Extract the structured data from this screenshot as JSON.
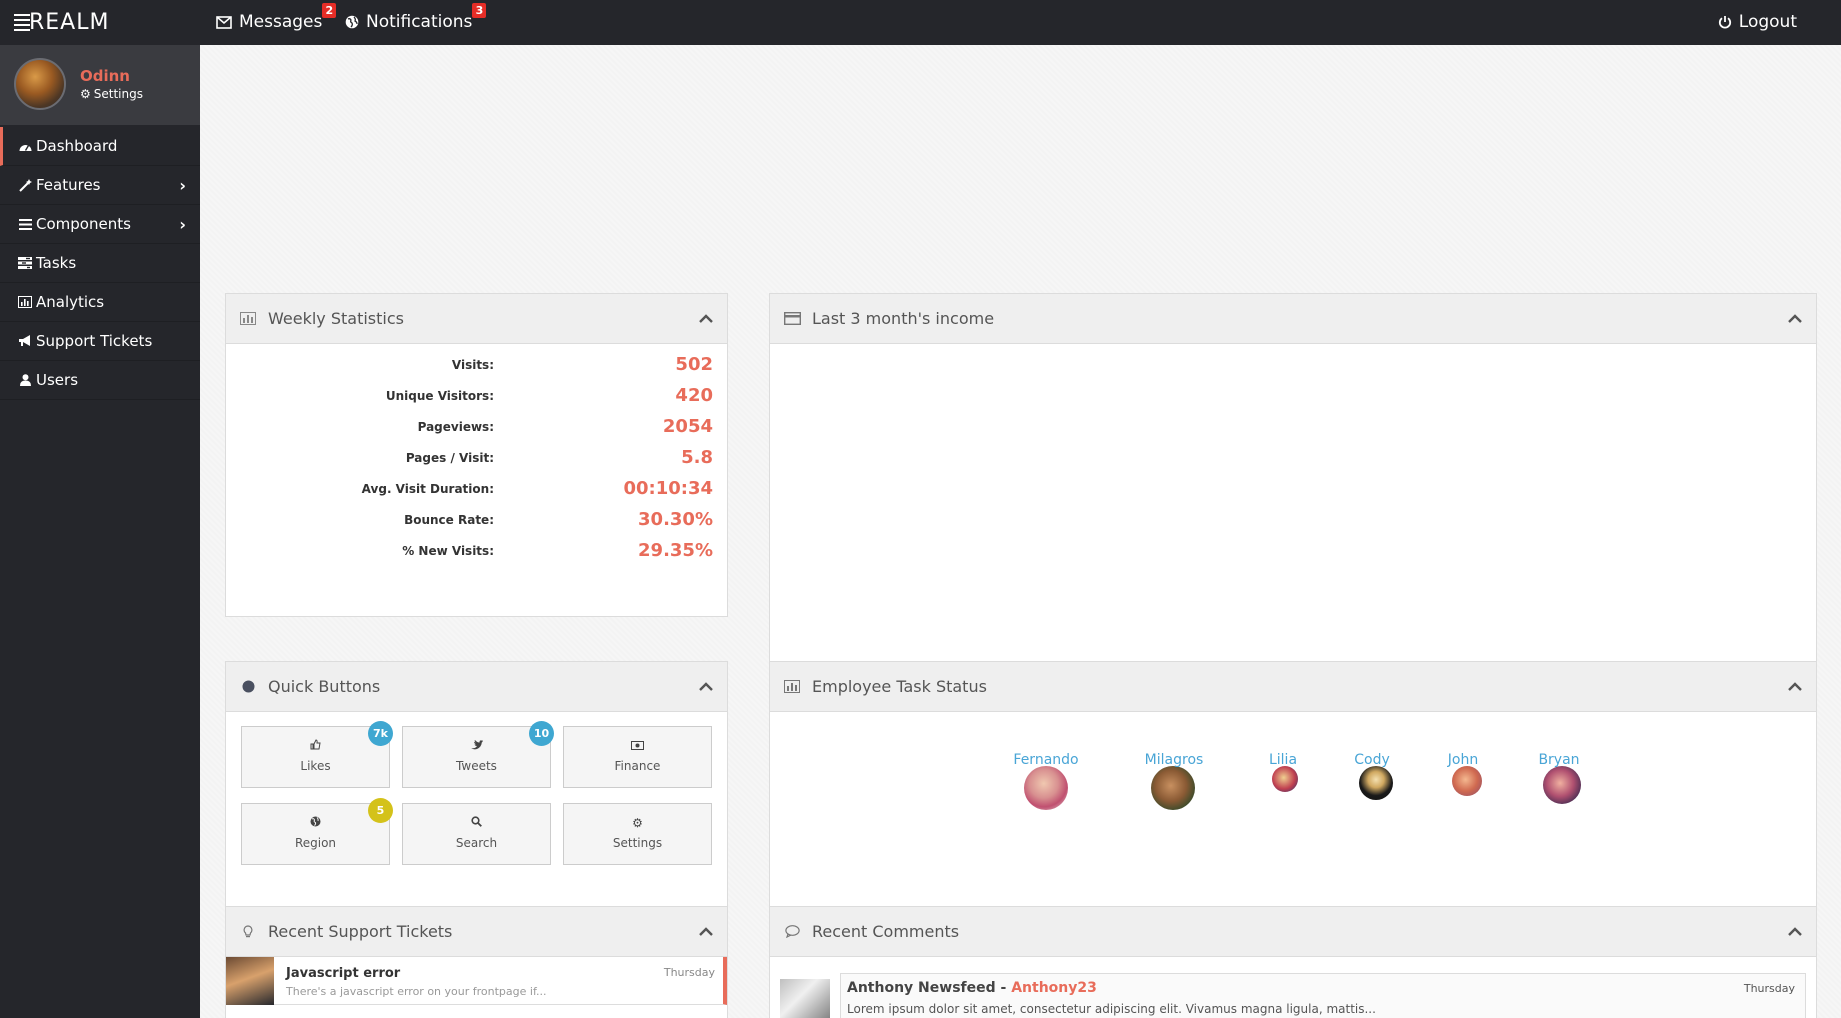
{
  "topbar": {
    "brand": "REALM",
    "messages": {
      "label": "Messages",
      "count": "2"
    },
    "notifications": {
      "label": "Notifications",
      "count": "3"
    },
    "logout": "Logout"
  },
  "user": {
    "name": "Odinn",
    "settings_label": "Settings"
  },
  "sidebar": {
    "items": [
      {
        "label": "Dashboard",
        "icon": "dashboard-icon"
      },
      {
        "label": "Features",
        "icon": "wand-icon"
      },
      {
        "label": "Components",
        "icon": "list-icon"
      },
      {
        "label": "Tasks",
        "icon": "tasks-icon"
      },
      {
        "label": "Analytics",
        "icon": "bar-chart-icon"
      },
      {
        "label": "Support Tickets",
        "icon": "bullhorn-icon"
      },
      {
        "label": "Users",
        "icon": "user-icon"
      }
    ]
  },
  "weekly_stats": {
    "title": "Weekly Statistics",
    "rows": [
      {
        "label": "Visits:",
        "value": "502"
      },
      {
        "label": "Unique Visitors:",
        "value": "420"
      },
      {
        "label": "Pageviews:",
        "value": "2054"
      },
      {
        "label": "Pages / Visit:",
        "value": "5.8"
      },
      {
        "label": "Avg. Visit Duration:",
        "value": "00:10:34"
      },
      {
        "label": "Bounce Rate:",
        "value": "30.30%"
      },
      {
        "label": "% New Visits:",
        "value": "29.35%"
      }
    ]
  },
  "income": {
    "title": "Last 3 month's income"
  },
  "quick_buttons": {
    "title": "Quick Buttons",
    "buttons": [
      {
        "label": "Likes",
        "icon": "thumbs-up-icon",
        "badge": "7k",
        "badge_color": "#3fa7d1"
      },
      {
        "label": "Tweets",
        "icon": "twitter-icon",
        "badge": "10",
        "badge_color": "#3fa7d1"
      },
      {
        "label": "Finance",
        "icon": "money-icon"
      },
      {
        "label": "Region",
        "icon": "globe-icon",
        "badge": "5",
        "badge_color": "#d4c21a"
      },
      {
        "label": "Search",
        "icon": "search-icon"
      },
      {
        "label": "Settings",
        "icon": "cogs-icon"
      }
    ]
  },
  "employee_status": {
    "title": "Employee Task Status",
    "employees": [
      {
        "name": "Fernando"
      },
      {
        "name": "Milagros"
      },
      {
        "name": "Lilia"
      },
      {
        "name": "Cody"
      },
      {
        "name": "John"
      },
      {
        "name": "Bryan"
      }
    ]
  },
  "support_tickets": {
    "title": "Recent Support Tickets",
    "tickets": [
      {
        "title": "Javascript error",
        "desc": "There's a javascript error on your frontpage if...",
        "date": "Thursday"
      }
    ]
  },
  "comments": {
    "title": "Recent Comments",
    "items": [
      {
        "author": "Anthony Newsfeed",
        "handle": "Anthony23",
        "date": "Thursday",
        "text": "Lorem ipsum dolor sit amet, consectetur adipiscing elit. Vivamus magna ligula, mattis..."
      }
    ]
  },
  "colors": {
    "accent": "#e86c5a",
    "dark": "#25262b",
    "link": "#49a5d6"
  }
}
